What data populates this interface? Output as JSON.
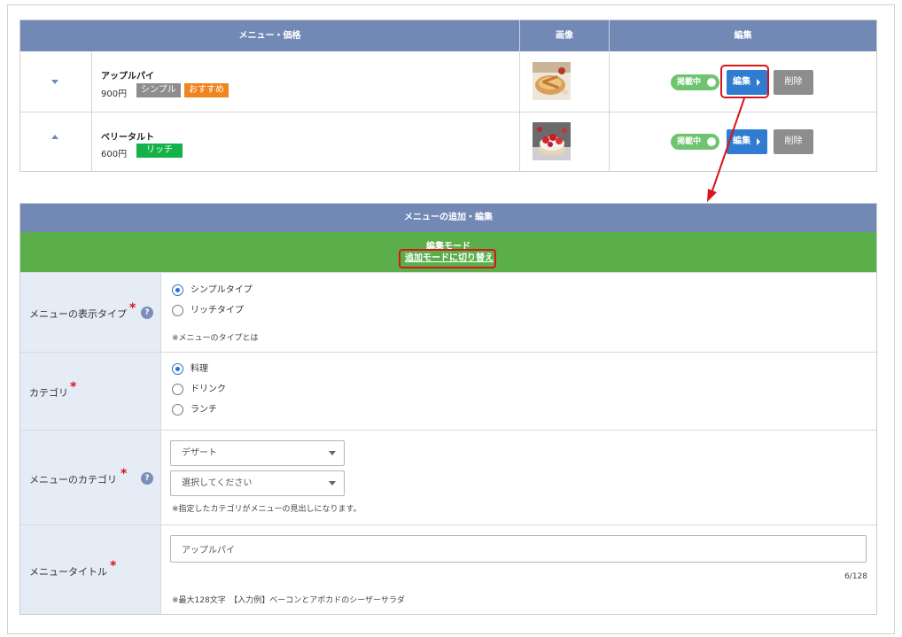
{
  "menu_table": {
    "headers": [
      "メニュー・価格",
      "画像",
      "編集"
    ],
    "rows": [
      {
        "name": "アップルパイ",
        "price": "900円",
        "tags": [
          "シンプル",
          "おすすめ"
        ],
        "status": "掲載中",
        "edit_label": "編集",
        "delete_label": "削除"
      },
      {
        "name": "ベリータルト",
        "price": "600円",
        "tags": [
          "リッチ"
        ],
        "status": "掲載中",
        "edit_label": "編集",
        "delete_label": "削除"
      }
    ]
  },
  "form": {
    "title": "メニューの追加・編集",
    "mode_title": "編集モード",
    "mode_switch_link": "追加モードに切り替え",
    "display_type": {
      "label": "メニューの表示タイプ",
      "options": [
        "シンプルタイプ",
        "リッチタイプ"
      ],
      "selected": "シンプルタイプ",
      "note": "※メニューのタイプとは"
    },
    "category": {
      "label": "カテゴリ",
      "options": [
        "料理",
        "ドリンク",
        "ランチ"
      ],
      "selected": "料理"
    },
    "menu_category": {
      "label": "メニューのカテゴリ",
      "select1_value": "デザート",
      "select2_value": "選択してください",
      "note": "※指定したカテゴリがメニューの見出しになります。"
    },
    "menu_title": {
      "label": "メニュータイトル",
      "value": "アップルパイ",
      "counter": "6/128",
      "note": "※最大128文字　【入力例】ベーコンとアボカドのシーザーサラダ"
    },
    "required_mark": "*",
    "help_mark": "?"
  },
  "colors": {
    "header_blue": "#7289b6",
    "mode_green": "#5aaf4b",
    "edit_blue": "#2f7cd1",
    "highlight_red": "#d8141c",
    "label_bg": "#e6ecf6"
  }
}
